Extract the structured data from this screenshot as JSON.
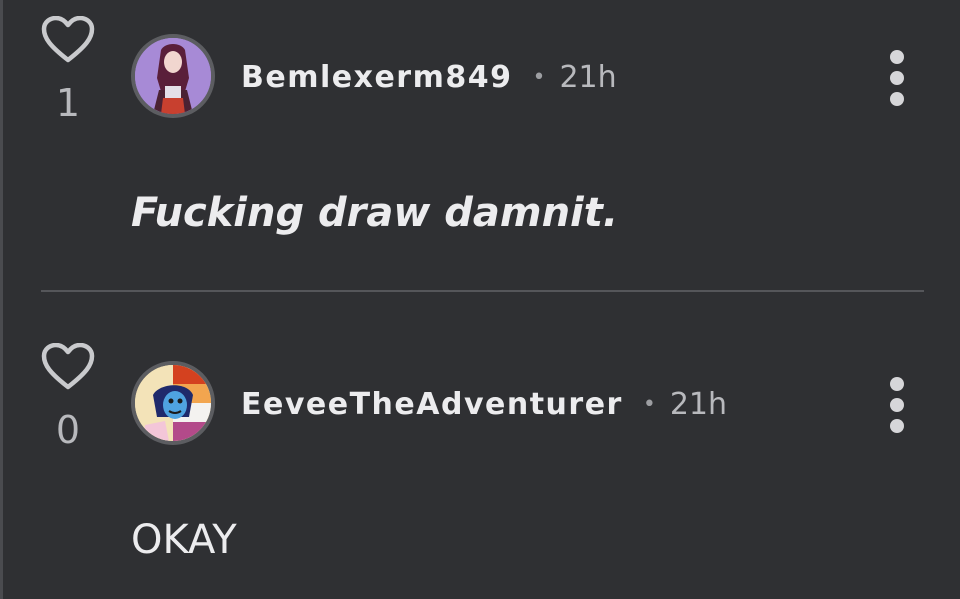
{
  "comments": [
    {
      "likes": "1",
      "username": "Bemlexerm849",
      "separator": "•",
      "time": "21h",
      "body": "Fucking draw damnit.",
      "avatar_icon": "anime-character-avatar",
      "avatar_bg": "#a78ad6"
    },
    {
      "likes": "0",
      "username": "EeveeTheAdventurer",
      "separator": "•",
      "time": "21h",
      "body": "OKAY",
      "avatar_icon": "cartoon-character-avatar",
      "avatar_bg": "#f0d9a8"
    }
  ],
  "icons": {
    "like": "heart-outline-icon",
    "more": "vertical-ellipsis-icon"
  },
  "colors": {
    "background": "#2f3033",
    "text": "#ececee",
    "muted": "#b8b9bd"
  }
}
